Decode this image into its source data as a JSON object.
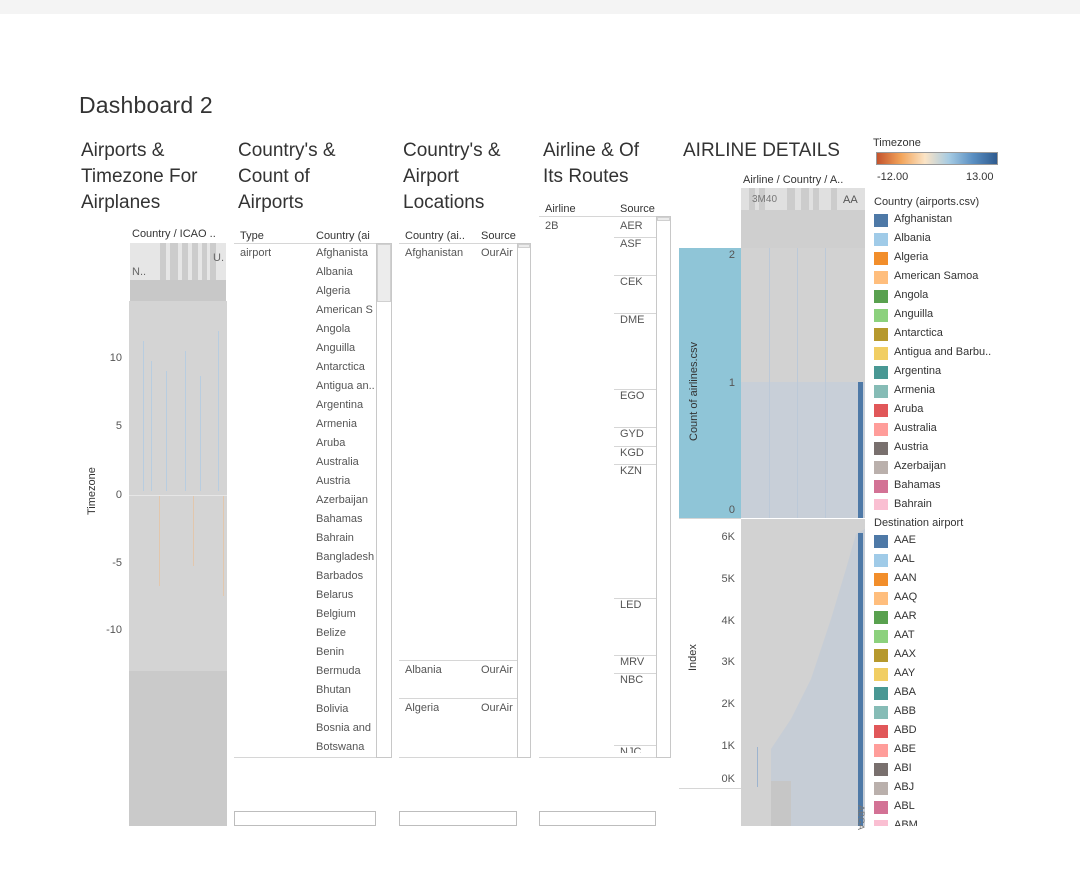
{
  "dashboard_title": "Dashboard 2",
  "panels": {
    "p1_title": "Airports &\nTimezone For\nAirplanes",
    "p2_title": "Country's &\nCount of\nAirports",
    "p3_title": "Country's &\nAirport\nLocations",
    "p4_title": "Airline & Of\nIts Routes",
    "p5_title": "AIRLINE DETAILS"
  },
  "p1": {
    "col_header": "Country / ICAO ..",
    "row_labels": [
      "N..",
      "U."
    ],
    "ylabel": "Timezone",
    "yticks": [
      "10",
      "5",
      "0",
      "-5",
      "-10"
    ]
  },
  "p2": {
    "col_type": "Type",
    "col_country": "Country (ai",
    "type_value": "airport",
    "countries": [
      "Afghanista",
      "Albania",
      "Algeria",
      "American S",
      "Angola",
      "Anguilla",
      "Antarctica",
      "Antigua an..",
      "Argentina",
      "Armenia",
      "Aruba",
      "Australia",
      "Austria",
      "Azerbaijan",
      "Bahamas",
      "Bahrain",
      "Bangladesh",
      "Barbados",
      "Belarus",
      "Belgium",
      "Belize",
      "Benin",
      "Bermuda",
      "Bhutan",
      "Bolivia",
      "Bosnia and",
      "Botswana"
    ]
  },
  "p3": {
    "col_country": "Country (ai..",
    "col_source": "Source",
    "rows": [
      {
        "country": "Afghanistan",
        "source": "OurAir"
      },
      {
        "country": "Albania",
        "source": "OurAir"
      },
      {
        "country": "Algeria",
        "source": "OurAir"
      }
    ]
  },
  "p4": {
    "col_airline": "Airline",
    "col_source": "Source",
    "airline": "2B",
    "sources": [
      "AER",
      "ASF",
      "CEK",
      "DME",
      "EGO",
      "GYD",
      "KGD",
      "KZN",
      "LED",
      "MRV",
      "NBC",
      "NJC"
    ]
  },
  "p5": {
    "col_header": "Airline / Country / A..",
    "top_labels": [
      "3M40",
      "AA"
    ],
    "upper_ylabel": "Count of airlines.csv",
    "upper_yticks": [
      "2",
      "1",
      "0"
    ],
    "lower_ylabel": "Index",
    "lower_yticks": [
      "6K",
      "5K",
      "4K",
      "3K",
      "2K",
      "1K",
      "0K"
    ],
    "bottom_label": "ABGA"
  },
  "legend": {
    "timezone_title": "Timezone",
    "timezone_min": "-12.00",
    "timezone_max": "13.00",
    "timezone_colors": [
      "#c4532d",
      "#f2a45a",
      "#fbe4c6",
      "#a6cbe3",
      "#5a8fc2",
      "#2f5b8f"
    ],
    "country_title": "Country (airports.csv)",
    "countries": [
      {
        "name": "Afghanistan",
        "color": "#4e79a7"
      },
      {
        "name": "Albania",
        "color": "#a0cbe8"
      },
      {
        "name": "Algeria",
        "color": "#f28e2b"
      },
      {
        "name": "American Samoa",
        "color": "#ffbe7d"
      },
      {
        "name": "Angola",
        "color": "#59a14f"
      },
      {
        "name": "Anguilla",
        "color": "#8cd17d"
      },
      {
        "name": "Antarctica",
        "color": "#b6992d"
      },
      {
        "name": "Antigua and Barbu..",
        "color": "#f1ce63"
      },
      {
        "name": "Argentina",
        "color": "#499894"
      },
      {
        "name": "Armenia",
        "color": "#86bcb6"
      },
      {
        "name": "Aruba",
        "color": "#e15759"
      },
      {
        "name": "Australia",
        "color": "#ff9d9a"
      },
      {
        "name": "Austria",
        "color": "#79706e"
      },
      {
        "name": "Azerbaijan",
        "color": "#bab0ac"
      },
      {
        "name": "Bahamas",
        "color": "#d37295"
      },
      {
        "name": "Bahrain",
        "color": "#fabfd2"
      }
    ],
    "dest_title": "Destination airport",
    "destinations": [
      {
        "name": "AAE",
        "color": "#4e79a7"
      },
      {
        "name": "AAL",
        "color": "#a0cbe8"
      },
      {
        "name": "AAN",
        "color": "#f28e2b"
      },
      {
        "name": "AAQ",
        "color": "#ffbe7d"
      },
      {
        "name": "AAR",
        "color": "#59a14f"
      },
      {
        "name": "AAT",
        "color": "#8cd17d"
      },
      {
        "name": "AAX",
        "color": "#b6992d"
      },
      {
        "name": "AAY",
        "color": "#f1ce63"
      },
      {
        "name": "ABA",
        "color": "#499894"
      },
      {
        "name": "ABB",
        "color": "#86bcb6"
      },
      {
        "name": "ABD",
        "color": "#e15759"
      },
      {
        "name": "ABE",
        "color": "#ff9d9a"
      },
      {
        "name": "ABI",
        "color": "#79706e"
      },
      {
        "name": "ABJ",
        "color": "#bab0ac"
      },
      {
        "name": "ABL",
        "color": "#d37295"
      },
      {
        "name": "ABM",
        "color": "#fabfd2"
      }
    ]
  },
  "chart_data": [
    {
      "type": "bar",
      "title": "Airports & Timezone For Airplanes",
      "ylabel": "Timezone",
      "ylim": [
        -13,
        13
      ],
      "yticks": [
        10,
        5,
        0,
        -5,
        -10
      ]
    },
    {
      "type": "bar",
      "title": "AIRLINE DETAILS",
      "ylabel": "Count of airlines.csv",
      "ylim": [
        0,
        2
      ],
      "yticks": [
        2,
        1,
        0
      ]
    },
    {
      "type": "area",
      "ylabel": "Index",
      "ylim": [
        0,
        6500
      ],
      "yticks": [
        "6K",
        "5K",
        "4K",
        "3K",
        "2K",
        "1K",
        "0K"
      ]
    }
  ]
}
